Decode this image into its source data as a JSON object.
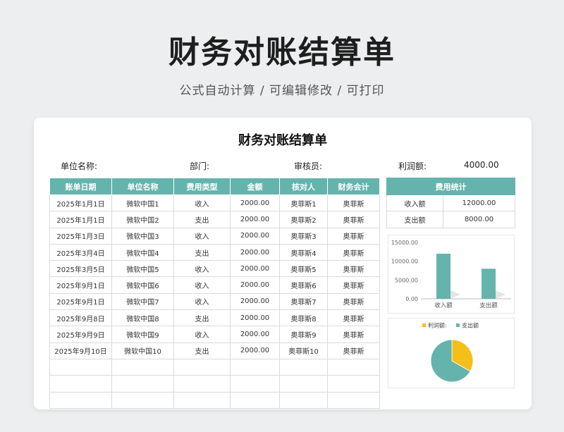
{
  "banner": {
    "title": "财务对账结算单",
    "subtitle": "公式自动计算 /  可编辑修改  / 可打印"
  },
  "sheet": {
    "title": "财务对账结算单",
    "info": {
      "unit_label": "单位名称:",
      "dept_label": "部门:",
      "auditor_label": "审核员:",
      "profit_label": "利润额:",
      "profit_value": "4000.00"
    },
    "ledger": {
      "headers": [
        "账单日期",
        "单位名称",
        "费用类型",
        "金额",
        "核对人",
        "财务会计"
      ],
      "rows": [
        [
          "2025年1月1日",
          "微软中国1",
          "收入",
          "2000.00",
          "奥菲斯1",
          "奥菲斯"
        ],
        [
          "2025年1月1日",
          "微软中国2",
          "支出",
          "2000.00",
          "奥菲斯2",
          "奥菲斯"
        ],
        [
          "2025年1月3日",
          "微软中国3",
          "收入",
          "2000.00",
          "奥菲斯3",
          "奥菲斯"
        ],
        [
          "2025年3月4日",
          "微软中国4",
          "支出",
          "2000.00",
          "奥菲斯4",
          "奥菲斯"
        ],
        [
          "2025年3月5日",
          "微软中国5",
          "收入",
          "2000.00",
          "奥菲斯5",
          "奥菲斯"
        ],
        [
          "2025年9月1日",
          "微软中国6",
          "收入",
          "2000.00",
          "奥菲斯6",
          "奥菲斯"
        ],
        [
          "2025年9月1日",
          "微软中国7",
          "收入",
          "2000.00",
          "奥菲斯7",
          "奥菲斯"
        ],
        [
          "2025年9月8日",
          "微软中国8",
          "支出",
          "2000.00",
          "奥菲斯8",
          "奥菲斯"
        ],
        [
          "2025年9月9日",
          "微软中国9",
          "收入",
          "2000.00",
          "奥菲斯9",
          "奥菲斯"
        ],
        [
          "2025年9月10日",
          "微软中国10",
          "支出",
          "2000.00",
          "奥菲斯10",
          "奥菲斯"
        ],
        [
          "",
          "",
          "",
          "",
          "",
          ""
        ],
        [
          "",
          "",
          "",
          "",
          "",
          ""
        ],
        [
          "",
          "",
          "",
          "",
          "",
          ""
        ]
      ]
    },
    "stats": {
      "header": "费用统计",
      "rows": [
        [
          "收入额",
          "12000.00"
        ],
        [
          "支出额",
          "8000.00"
        ]
      ]
    }
  },
  "colors": {
    "accent": "#64b4ad",
    "pie_profit": "#f5bf1a",
    "pie_expense": "#64b4ad"
  },
  "chart_data": [
    {
      "type": "bar",
      "categories": [
        "收入额",
        "支出额"
      ],
      "values": [
        12000,
        8000
      ],
      "ylim": [
        0,
        15000
      ],
      "yticks": [
        "0.00",
        "5000.00",
        "10000.00",
        "15000.00"
      ],
      "ytick_values": [
        0,
        5000,
        10000,
        15000
      ],
      "grid": false
    },
    {
      "type": "pie",
      "labels": [
        "利润额:",
        "支出额"
      ],
      "values": [
        4000,
        8000
      ],
      "legend": "top"
    }
  ]
}
